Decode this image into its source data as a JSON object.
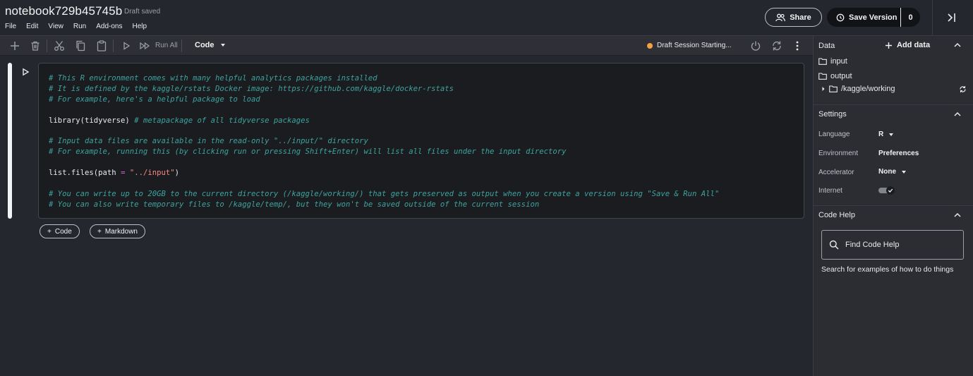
{
  "header": {
    "title": "notebook729b45745b",
    "draft_status": "Draft saved",
    "menu": [
      "File",
      "Edit",
      "View",
      "Run",
      "Add-ons",
      "Help"
    ],
    "share_label": "Share",
    "save_label": "Save Version",
    "save_count": "0"
  },
  "toolbar": {
    "run_all_label": "Run All",
    "cell_type": "Code",
    "session_status": "Draft Session Starting...",
    "status_color": "#f5a142",
    "icons": [
      "plus-icon",
      "trash-icon",
      "scissors-icon",
      "copy-icon",
      "paste-icon",
      "play-icon",
      "fast-forward-icon",
      "power-icon",
      "refresh-icon",
      "more-vertical-icon"
    ]
  },
  "cell": {
    "lines": [
      [
        {
          "t": "# This R environment comes with many helpful analytics packages installed",
          "c": "comment"
        }
      ],
      [
        {
          "t": "# It is defined by the kaggle/rstats Docker image: https://github.com/kaggle/docker-rstats",
          "c": "comment"
        }
      ],
      [
        {
          "t": "# For example, here's a helpful package to load",
          "c": "comment"
        }
      ],
      [],
      [
        {
          "t": "library(tidyverse) ",
          "c": "plain"
        },
        {
          "t": "# metapackage of all tidyverse packages",
          "c": "comment"
        }
      ],
      [],
      [
        {
          "t": "# Input data files are available in the read-only \"../input/\" directory",
          "c": "comment"
        }
      ],
      [
        {
          "t": "# For example, running this (by clicking run or pressing Shift+Enter) will list all files under the input directory",
          "c": "comment"
        }
      ],
      [],
      [
        {
          "t": "list.files(path ",
          "c": "plain"
        },
        {
          "t": "=",
          "c": "op"
        },
        {
          "t": " ",
          "c": "plain"
        },
        {
          "t": "\"../input\"",
          "c": "str"
        },
        {
          "t": ")",
          "c": "plain"
        }
      ],
      [],
      [
        {
          "t": "# You can write up to 20GB to the current directory (/kaggle/working/) that gets preserved as output when you create a version using \"Save & Run All\"",
          "c": "comment"
        }
      ],
      [
        {
          "t": "# You can also write temporary files to /kaggle/temp/, but they won't be saved outside of the current session",
          "c": "comment"
        }
      ]
    ],
    "add_code_label": "Code",
    "add_markdown_label": "Markdown"
  },
  "panel": {
    "data": {
      "title": "Data",
      "add_label": "Add data",
      "folders": [
        "input",
        "output"
      ],
      "working_dir": "/kaggle/working"
    },
    "settings": {
      "title": "Settings",
      "language_label": "Language",
      "language_value": "R",
      "environment_label": "Environment",
      "environment_value": "Preferences",
      "accelerator_label": "Accelerator",
      "accelerator_value": "None",
      "internet_label": "Internet",
      "internet_on": true
    },
    "code_help": {
      "title": "Code Help",
      "search_placeholder": "Find Code Help",
      "hint": "Search for examples of how to do things"
    }
  }
}
